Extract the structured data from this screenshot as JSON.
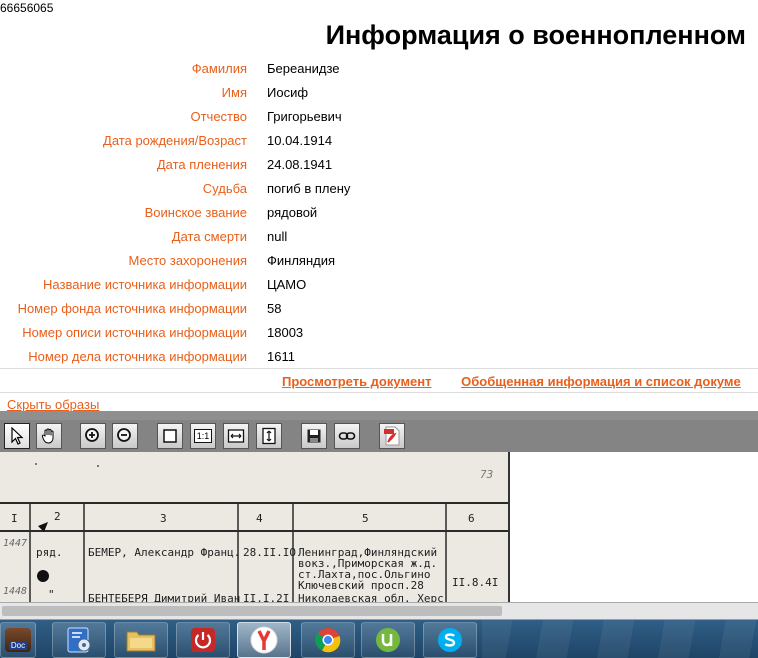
{
  "record_id": "66656065",
  "page_title": "Информация о военнопленном",
  "fields": [
    {
      "label": "Фамилия",
      "value": "Береанидзе"
    },
    {
      "label": "Имя",
      "value": "Иосиф"
    },
    {
      "label": "Отчество",
      "value": "Григорьевич"
    },
    {
      "label": "Дата рождения/Возраст",
      "value": "10.04.1914"
    },
    {
      "label": "Дата пленения",
      "value": "24.08.1941"
    },
    {
      "label": "Судьба",
      "value": "погиб в плену"
    },
    {
      "label": "Воинское звание",
      "value": "рядовой"
    },
    {
      "label": "Дата смерти",
      "value": "null"
    },
    {
      "label": "Место захоронения",
      "value": "Финляндия"
    },
    {
      "label": "Название источника информации",
      "value": "ЦАМО"
    },
    {
      "label": "Номер фонда источника информации",
      "value": "58"
    },
    {
      "label": "Номер описи источника информации",
      "value": "18003"
    },
    {
      "label": "Номер дела источника информации",
      "value": "1611"
    }
  ],
  "links": {
    "view_document": "Просмотреть документ",
    "summary_info": "Обобщенная информация и список докуме",
    "hide_images": "Скрыть образы"
  },
  "toolbar": {
    "buttons": [
      "select-tool",
      "hand-tool",
      "zoom-in",
      "zoom-out",
      "full-page",
      "actual-size",
      "fit-width",
      "fit-height",
      "save",
      "link",
      "pdf"
    ],
    "actual_size_label": "1:1"
  },
  "scan": {
    "column_numbers": [
      "I",
      "2",
      "3",
      "4",
      "5",
      "6"
    ],
    "corner_mark": "73",
    "rows": [
      {
        "number": "1447",
        "rank": "ряд.",
        "name": "БЕМЕР, Александр Франц.",
        "date": "28.II.IO",
        "address_lines": [
          "Ленинград,Финляндский",
          "вокз.,Приморская ж.д.",
          "ст.Лахта,пос.Ольгино",
          "Ключевский просп.28"
        ],
        "death": "II.8.4I"
      },
      {
        "number": "1448",
        "rank": "\"",
        "name": "БЕНТЕБЕРЯ Димитрий Иван",
        "date": "II.I.2I",
        "address_lines": [
          "Николаевская обл. Херс"
        ],
        "death": ""
      }
    ]
  },
  "taskbar": {
    "apps": [
      "doc-app",
      "control-panel",
      "file-explorer",
      "power-app",
      "yandex-browser",
      "chrome",
      "utorrent",
      "skype"
    ],
    "active": "yandex-browser",
    "doc_label": "Doc"
  },
  "colors": {
    "label_orange": "#e8601c",
    "toolbar_gray": "#848484",
    "taskbar_blue": "#2a587f"
  }
}
